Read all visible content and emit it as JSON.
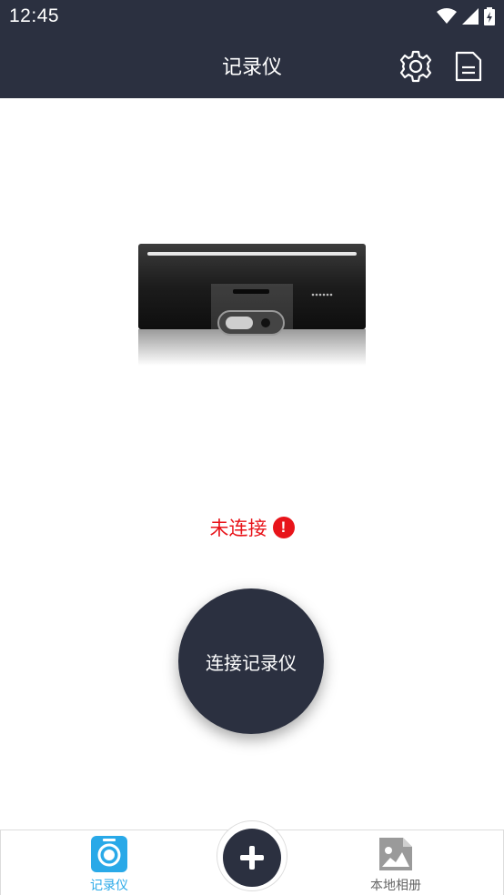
{
  "status_bar": {
    "time": "12:45",
    "icons": [
      "wifi-icon",
      "signal-icon",
      "battery-charging-icon"
    ]
  },
  "app_bar": {
    "title": "记录仪",
    "actions": [
      "settings-gear-icon",
      "document-icon"
    ]
  },
  "device": {
    "image": "dashcam-device-image"
  },
  "connection": {
    "status_text": "未连接",
    "status_icon": "warning-icon",
    "status_color": "#e8141a"
  },
  "connect_button": {
    "label": "连接记录仪"
  },
  "bottom_nav": {
    "items": [
      {
        "label": "记录仪",
        "icon": "camera-icon",
        "active": true
      },
      {
        "label": "本地相册",
        "icon": "image-icon",
        "active": false
      }
    ],
    "center_action": "plus-icon"
  },
  "colors": {
    "primary": "#2b3040",
    "accent": "#29a9e8",
    "error": "#e8141a"
  }
}
